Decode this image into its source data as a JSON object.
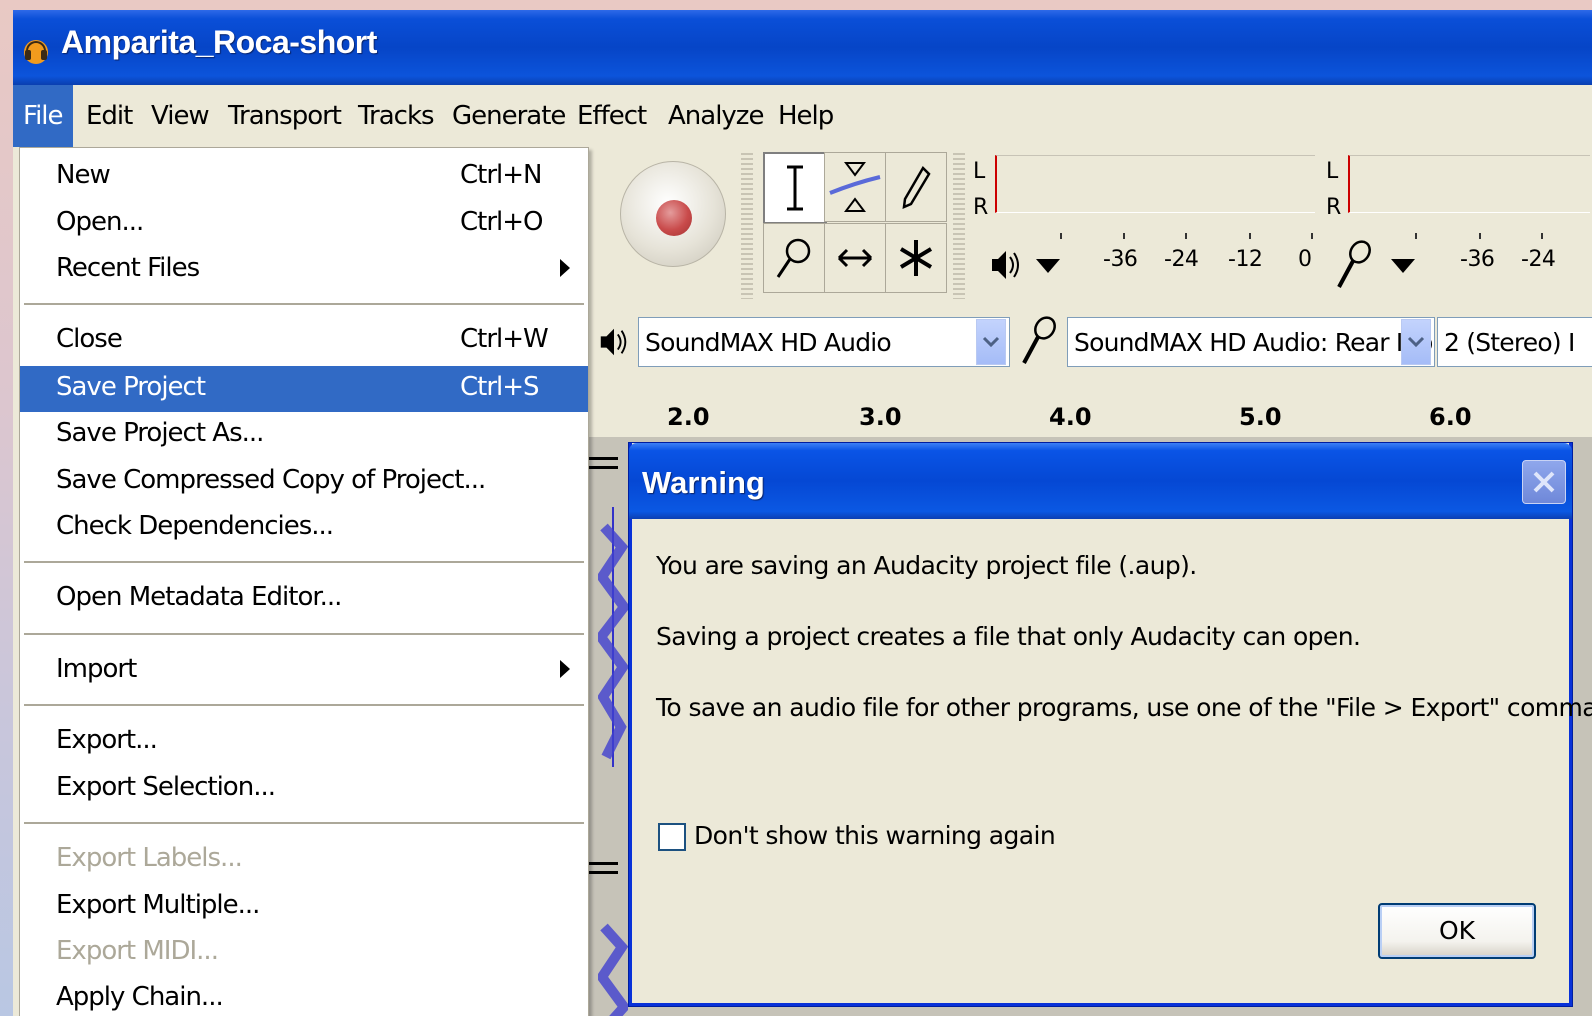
{
  "window": {
    "title": "Amparita_Roca-short"
  },
  "menubar": {
    "items": [
      "File",
      "Edit",
      "View",
      "Transport",
      "Tracks",
      "Generate",
      "Effect",
      "Analyze",
      "Help"
    ]
  },
  "file_menu": {
    "items": [
      {
        "label": "New",
        "shortcut": "Ctrl+N"
      },
      {
        "label": "Open...",
        "shortcut": "Ctrl+O"
      },
      {
        "label": "Recent Files",
        "submenu": true
      },
      {
        "label": "Close",
        "shortcut": "Ctrl+W"
      },
      {
        "label": "Save Project",
        "shortcut": "Ctrl+S",
        "highlighted": true
      },
      {
        "label": "Save Project As..."
      },
      {
        "label": "Save Compressed Copy of Project..."
      },
      {
        "label": "Check Dependencies..."
      },
      {
        "label": "Open Metadata Editor..."
      },
      {
        "label": "Import",
        "submenu": true
      },
      {
        "label": "Export..."
      },
      {
        "label": "Export Selection..."
      },
      {
        "label": "Export Labels...",
        "disabled": true
      },
      {
        "label": "Export Multiple..."
      },
      {
        "label": "Export MIDI...",
        "disabled": true
      },
      {
        "label": "Apply Chain..."
      }
    ]
  },
  "meters": {
    "playback": {
      "left": "L",
      "right": "R"
    },
    "record": {
      "left": "L",
      "right": "R"
    },
    "scale": [
      "-36",
      "-24",
      "-12",
      "0"
    ],
    "scale_record": [
      "-36",
      "-24"
    ]
  },
  "device": {
    "playback": "SoundMAX HD Audio",
    "recording": "SoundMAX HD Audio: Rear Inp",
    "channels": "2 (Stereo) I"
  },
  "ruler": {
    "labels": [
      "2.0",
      "3.0",
      "4.0",
      "5.0",
      "6.0"
    ]
  },
  "dialog": {
    "title": "Warning",
    "line1": "You are saving an Audacity project file (.aup).",
    "line2": "Saving a project creates a file that only Audacity can open.",
    "line3": "To save an audio file for other programs, use one of the \"File > Export\" commands.",
    "checkbox_label": "Don't show this warning again",
    "ok_label": "OK"
  },
  "colors": {
    "title_blue": "#0645c7",
    "highlight": "#316ac5",
    "background": "#ece9d8"
  }
}
